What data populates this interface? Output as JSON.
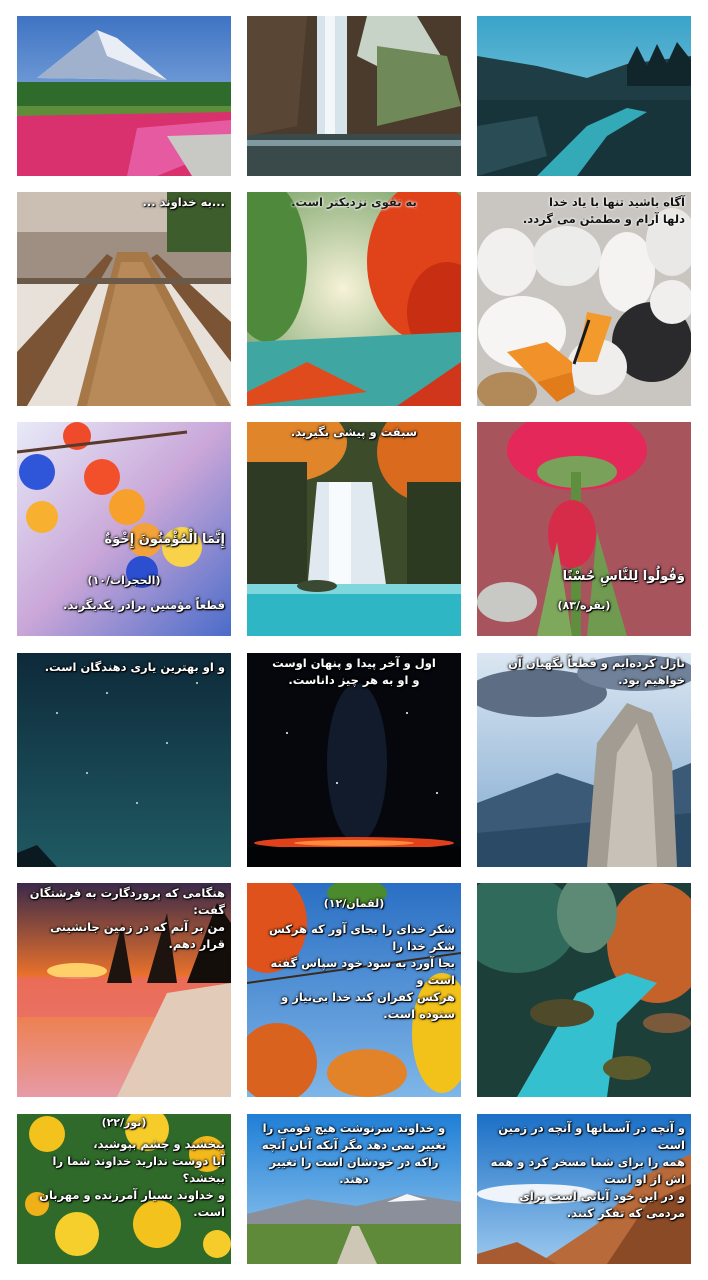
{
  "gallery": {
    "tiles": [
      {
        "id": "mountain-flower-field",
        "caption": ""
      },
      {
        "id": "cave-waterfall",
        "caption": ""
      },
      {
        "id": "river-valley",
        "caption": ""
      },
      {
        "id": "wooden-boardwalk",
        "caption": "...به خداوند ..."
      },
      {
        "id": "autumn-forest-lake",
        "caption": "به تقوی نزدیکتر است."
      },
      {
        "id": "white-stones-butterfly",
        "caption": "آگاه باشید تنها با یاد خدا\nدلها آرام و مطمئن می گردد."
      },
      {
        "id": "spring-blossoms",
        "caption": "إِنَّمَا الْمُؤْمِنُونَ إِخْوَةٌ",
        "reference": "(الحجرات/١٠)",
        "caption2": "قطعاً مؤمنین برادر یکدیگرند."
      },
      {
        "id": "jungle-waterfall",
        "caption": "سبقت و پیشی بگیرید."
      },
      {
        "id": "red-tulips",
        "caption": "وَقُولُوا لِلنَّاسِ حُسْنًا",
        "reference": "(بقره/٨٣)"
      },
      {
        "id": "night-sky-stars",
        "caption": "و او بهترین یاری دهندگان است."
      },
      {
        "id": "starry-horizon",
        "caption": "اول و آخر پیدا و پنهان اوست\nو او به هر چیز داناست."
      },
      {
        "id": "rock-cliff-sky",
        "caption": "نازل کرده‌ایم و قطعاً نگهبان آن خواهیم بود."
      },
      {
        "id": "tropical-sunset-beach",
        "caption": "هنگامی که پروردگارت به فرشتگان گفت:\nمن بر آنم که در زمین جانشینی قرار دهم."
      },
      {
        "id": "autumn-leaves-sky",
        "reference": "(لقمان/١٢)",
        "caption": "شکر خدای را بجای آور که هرکس شکر خدا را\nبجا آورد به سود خود سپاس گفته است و\nهرکس کفران کند خدا بی‌نیاز و ستوده است."
      },
      {
        "id": "turquoise-stream",
        "caption": ""
      },
      {
        "id": "yellow-daffodils",
        "reference": "(نور/٢٢)",
        "caption": "ببخشید و چشم بپوشید،\nآیا دوست ندارید خداوند شما را ببخشد؟\nو خداوند بسیار آمرزنده و مهربان است."
      },
      {
        "id": "road-snowy-mountains",
        "caption": "و خداوند سرنوشت هیچ قومی را\nتغییر نمی دهد مگر آنکه آنان آنچه\nراکه در خودشان است را تغییر دهند."
      },
      {
        "id": "desert-rocks-sky",
        "caption": "و آنچه در آسمانها و آنچه در زمین است\nهمه را برای شما مسخر کرد و همه اش از او است\nو در این خود آیاتی است برای مردمی که تفکر کنند."
      }
    ]
  }
}
